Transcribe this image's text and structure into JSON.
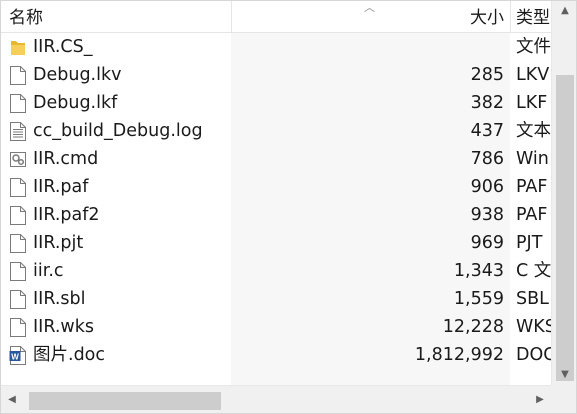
{
  "header": {
    "name": "名称",
    "size": "大小",
    "type": "类型"
  },
  "files": [
    {
      "name": "IIR.CS_",
      "size": "",
      "type": "文件",
      "icon": "folder-icon"
    },
    {
      "name": "Debug.lkv",
      "size": "285",
      "type": "LKV",
      "icon": "file-icon"
    },
    {
      "name": "Debug.lkf",
      "size": "382",
      "type": "LKF",
      "icon": "file-icon"
    },
    {
      "name": "cc_build_Debug.log",
      "size": "437",
      "type": "文本",
      "icon": "text-file-icon"
    },
    {
      "name": "IIR.cmd",
      "size": "786",
      "type": "Win",
      "icon": "cmd-file-icon"
    },
    {
      "name": "IIR.paf",
      "size": "906",
      "type": "PAF",
      "icon": "file-icon"
    },
    {
      "name": "IIR.paf2",
      "size": "938",
      "type": "PAF",
      "icon": "file-icon"
    },
    {
      "name": "IIR.pjt",
      "size": "969",
      "type": "PJT",
      "icon": "file-icon"
    },
    {
      "name": "iir.c",
      "size": "1,343",
      "type": "C 文",
      "icon": "file-icon"
    },
    {
      "name": "IIR.sbl",
      "size": "1,559",
      "type": "SBL",
      "icon": "file-icon"
    },
    {
      "name": "IIR.wks",
      "size": "12,228",
      "type": "WKS",
      "icon": "file-icon"
    },
    {
      "name": "图片.doc",
      "size": "1,812,992",
      "type": "DOC",
      "icon": "word-doc-icon"
    }
  ],
  "colors": {
    "folder": "#e8b830",
    "word": "#2b579a",
    "size_column_bg": "#f7f7f7",
    "scrollbar_thumb": "#cdcdcd"
  }
}
